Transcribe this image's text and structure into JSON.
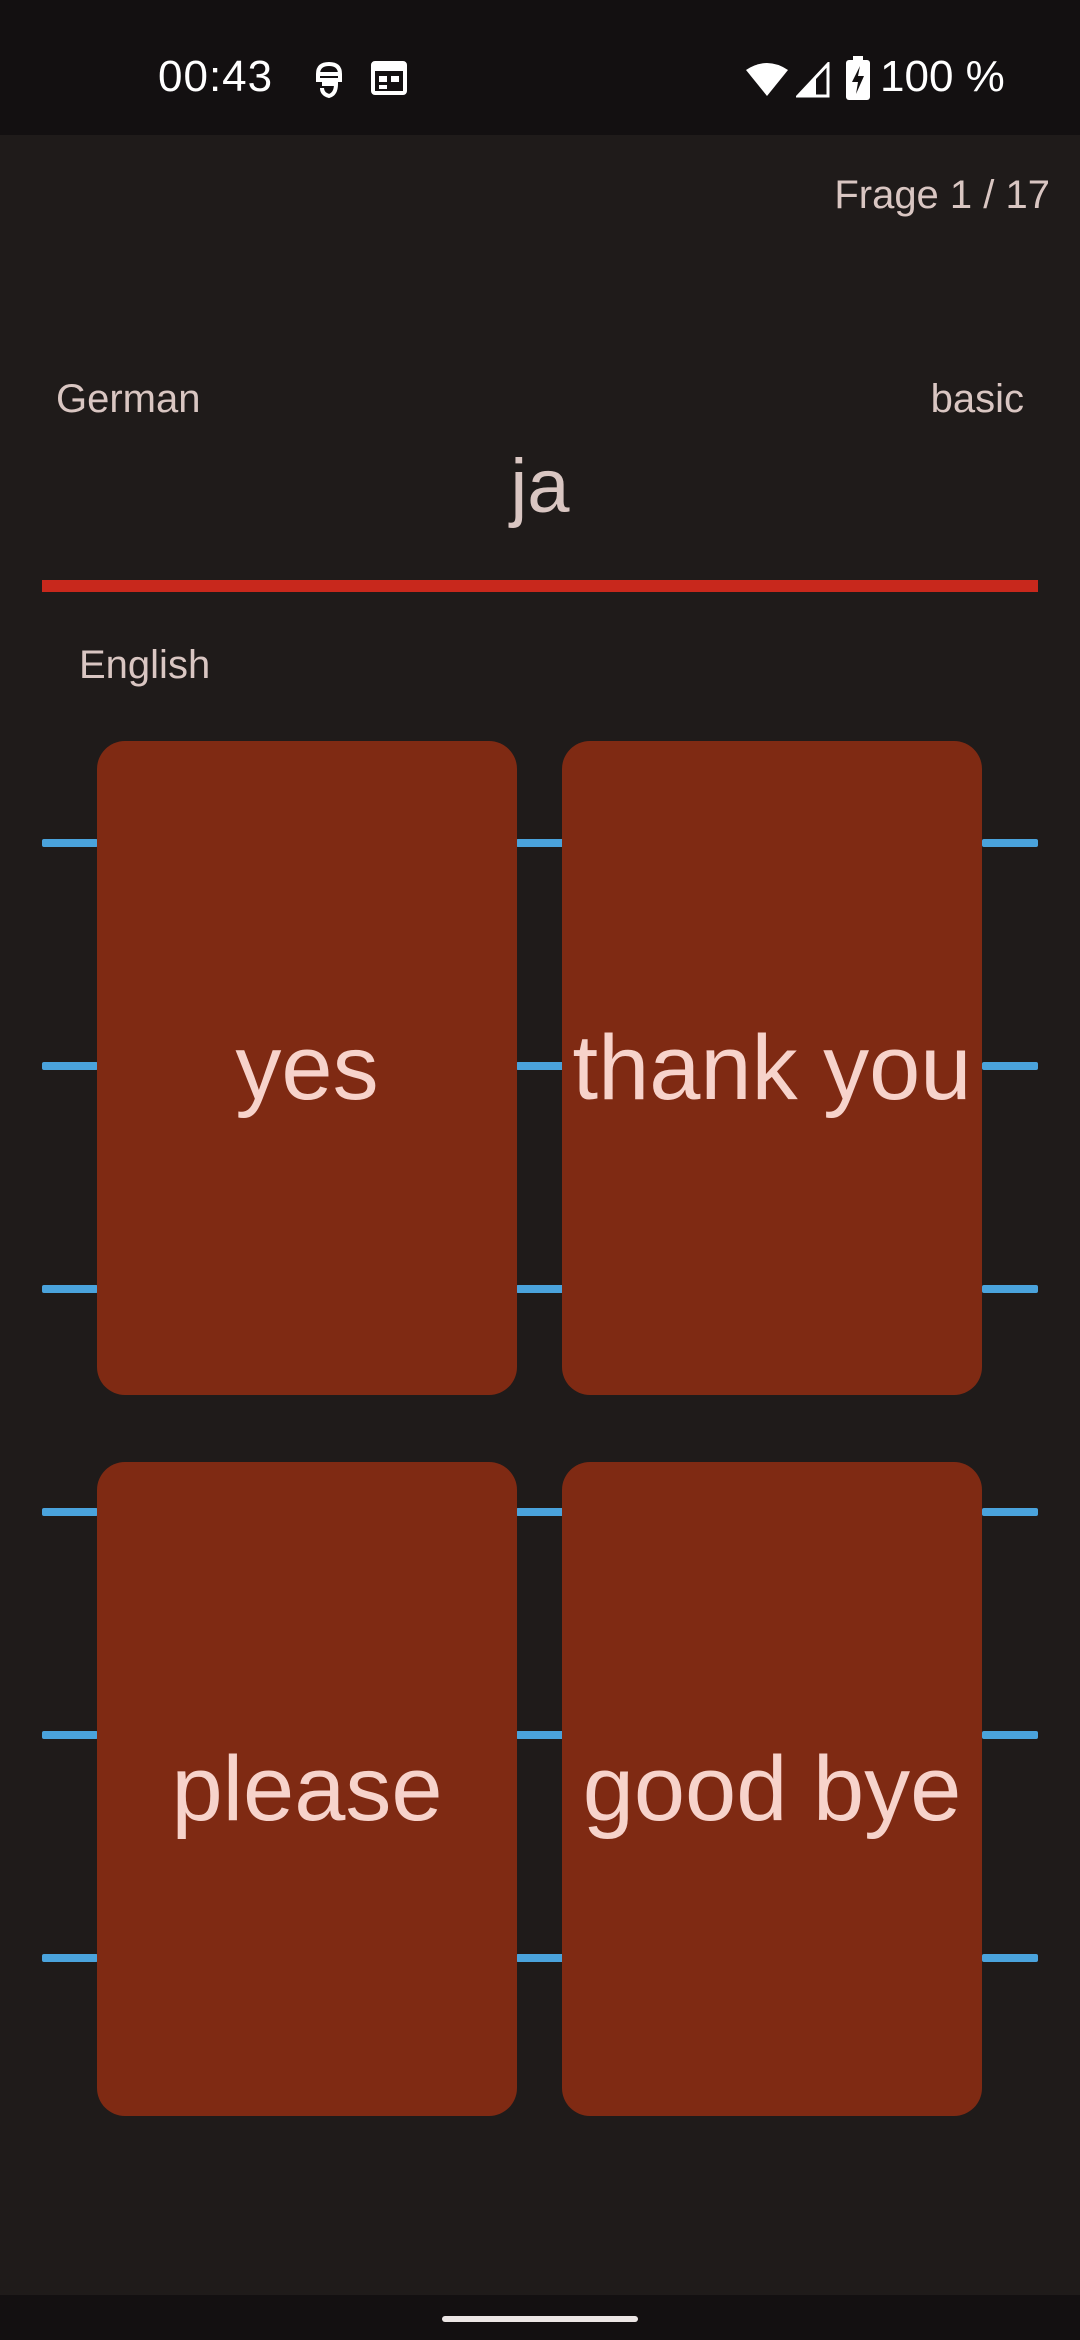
{
  "status_bar": {
    "time": "00:43",
    "battery": "100 %",
    "icons": [
      "app-notification-icon",
      "calendar-icon",
      "wifi-icon",
      "cell-signal-icon",
      "battery-charging-icon"
    ]
  },
  "quiz": {
    "counter": "Frage 1 / 17",
    "source_language": "German",
    "level": "basic",
    "word": "ja",
    "target_language": "English",
    "answers": [
      "yes",
      "thank you",
      "please",
      "good bye"
    ]
  },
  "colors": {
    "background": "#1f1b1a",
    "status_bar": "#131011",
    "card": "#7f2a13",
    "card_text": "#f7d3cb",
    "accent_line": "#c8281c",
    "connector_line": "#4aa3dc"
  }
}
